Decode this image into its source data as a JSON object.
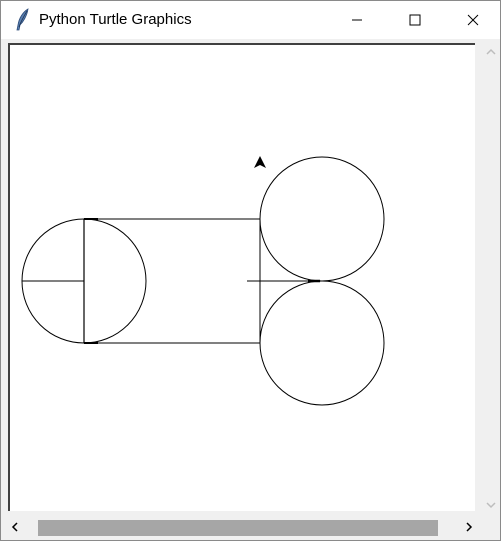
{
  "window": {
    "title": "Python Turtle Graphics",
    "app_icon": "feather-icon",
    "controls": {
      "minimize_icon": "minimize-icon",
      "maximize_icon": "maximize-icon",
      "close_icon": "close-icon"
    }
  },
  "canvas": {
    "background": "#ffffff",
    "stroke_color": "#000000",
    "turtle_icon": "turtle-arrow-icon"
  },
  "scrollbars": {
    "vertical": {
      "up_icon": "chevron-up-icon",
      "down_icon": "chevron-down-icon"
    },
    "horizontal": {
      "left_icon": "chevron-left-icon",
      "right_icon": "chevron-right-icon"
    }
  }
}
